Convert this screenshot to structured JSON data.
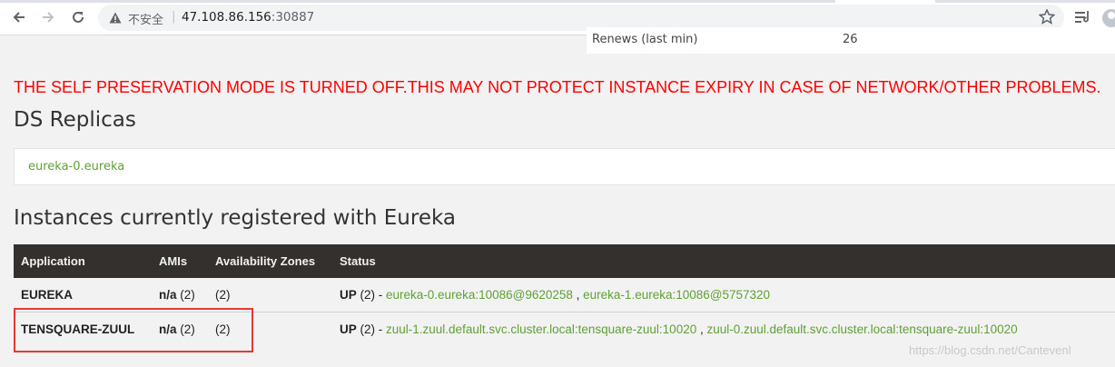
{
  "browser": {
    "security_label": "不安全",
    "url_host": "47.108.86.156",
    "url_port": ":30887",
    "icons": [
      "back-icon",
      "forward-icon",
      "reload-icon",
      "warning-icon",
      "star-icon",
      "reading-list-icon",
      "profile-avatar-icon"
    ]
  },
  "general": {
    "renews_label": "Renews (last min)",
    "renews_value": "26"
  },
  "self_preservation_message": "THE SELF PRESERVATION MODE IS TURNED OFF.THIS MAY NOT PROTECT INSTANCE EXPIRY IN CASE OF NETWORK/OTHER PROBLEMS.",
  "ds_replicas": {
    "title": "DS Replicas",
    "items": [
      "eureka-0.eureka"
    ]
  },
  "instances": {
    "title": "Instances currently registered with Eureka",
    "columns": [
      "Application",
      "AMIs",
      "Availability Zones",
      "Status"
    ],
    "rows": [
      {
        "application": "EUREKA",
        "amis_value": "n/a",
        "amis_count": " (2)",
        "zones": "(2)",
        "status": "UP",
        "status_count": " (2) - ",
        "links": [
          "eureka-0.eureka:10086@9620258",
          "eureka-1.eureka:10086@5757320"
        ],
        "link_sep": " , "
      },
      {
        "application": "TENSQUARE-ZUUL",
        "amis_value": "n/a",
        "amis_count": " (2)",
        "zones": "(2)",
        "status": "UP",
        "status_count": " (2) - ",
        "links": [
          "zuul-1.zuul.default.svc.cluster.local:tensquare-zuul:10020",
          "zuul-0.zuul.default.svc.cluster.local:tensquare-zuul:10020"
        ],
        "link_sep": " , "
      }
    ]
  },
  "watermark": "https://blog.csdn.net/Cantevenl",
  "colors": {
    "error": "#ff0000",
    "link": "#5fa134",
    "table_header": "#34302d",
    "annotation": "#e53935"
  }
}
